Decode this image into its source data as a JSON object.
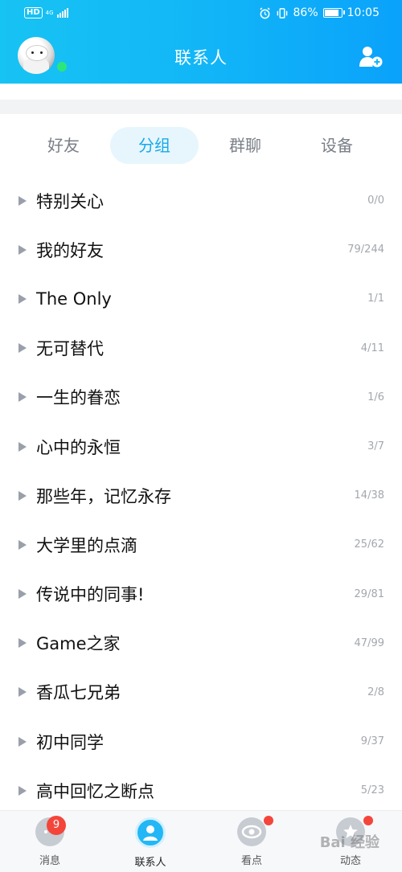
{
  "status_bar": {
    "hd_label": "HD",
    "network": "4G",
    "battery_percent": "86%",
    "time": "10:05"
  },
  "header": {
    "title": "联系人",
    "avatar_icon": "avatar",
    "add_contact_icon": "add-contact-icon"
  },
  "tabs": [
    {
      "label": "好友",
      "active": false
    },
    {
      "label": "分组",
      "active": true
    },
    {
      "label": "群聊",
      "active": false
    },
    {
      "label": "设备",
      "active": false
    }
  ],
  "groups": [
    {
      "name": "特别关心",
      "count": "0/0"
    },
    {
      "name": "我的好友",
      "count": "79/244"
    },
    {
      "name": "The Only",
      "count": "1/1"
    },
    {
      "name": "无可替代",
      "count": "4/11"
    },
    {
      "name": "一生的眷恋",
      "count": "1/6"
    },
    {
      "name": "心中的永恒",
      "count": "3/7"
    },
    {
      "name": "那些年，记忆永存",
      "count": "14/38"
    },
    {
      "name": "大学里的点滴",
      "count": "25/62"
    },
    {
      "name": "传说中的同事!",
      "count": "29/81"
    },
    {
      "name": "Game之家",
      "count": "47/99"
    },
    {
      "name": "香瓜七兄弟",
      "count": "2/8"
    },
    {
      "name": "初中同学",
      "count": "9/37"
    },
    {
      "name": "高中回忆之断点",
      "count": "5/23"
    }
  ],
  "bottom_nav": {
    "messages": {
      "label": "消息",
      "badge": "9"
    },
    "contacts": {
      "label": "联系人"
    },
    "look": {
      "label": "看点"
    },
    "feed": {
      "label": "动态"
    }
  },
  "watermark": "Bai 经验",
  "colors": {
    "header_start": "#17c3f3",
    "header_end": "#0aa2fb",
    "accent": "#17a9e9",
    "badge_red": "#f4453b"
  }
}
